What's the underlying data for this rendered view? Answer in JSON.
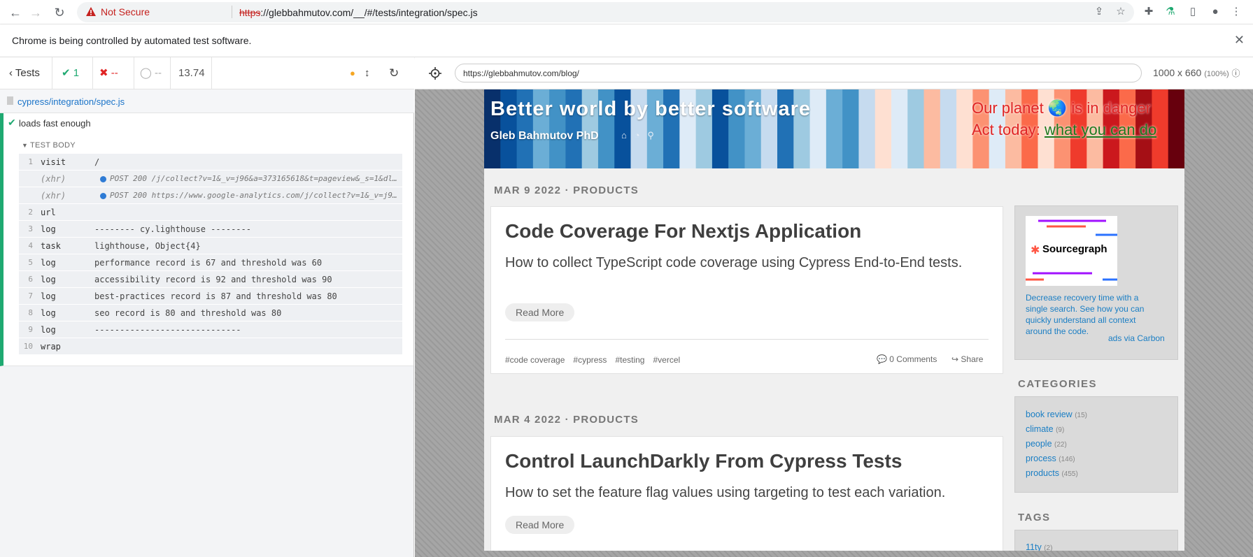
{
  "browser": {
    "security_label": "Not Secure",
    "url_scheme": "https",
    "url_rest": "://glebbahmutov.com/__/#/tests/integration/spec.js",
    "infobar_message": "Chrome is being controlled by automated test software.",
    "close_glyph": "✕"
  },
  "reporter": {
    "back_label": "Tests",
    "passed": "1",
    "failed": "--",
    "pending": "--",
    "duration": "13.74",
    "spec_file": "cypress/integration/spec.js",
    "test_title": "loads fast enough",
    "body_header": "TEST BODY",
    "commands": [
      {
        "num": "1",
        "name": "visit",
        "msg": "/",
        "xhr": false
      },
      {
        "num": "",
        "name": "(xhr)",
        "msg": "POST 200 /j/collect?v=1&_v=j96&a=373165618&t=pageview&_s=1&dl=http…",
        "xhr": true
      },
      {
        "num": "",
        "name": "(xhr)",
        "msg": "POST 200 https://www.google-analytics.com/j/collect?v=1&_v=j96&a=3…",
        "xhr": true
      },
      {
        "num": "2",
        "name": "url",
        "msg": "",
        "xhr": false
      },
      {
        "num": "3",
        "name": "log",
        "msg": "-------- cy.lighthouse --------",
        "xhr": false
      },
      {
        "num": "4",
        "name": "task",
        "msg": "lighthouse, Object{4}",
        "xhr": false
      },
      {
        "num": "5",
        "name": "log",
        "msg": "performance record is 67 and threshold was 60",
        "xhr": false
      },
      {
        "num": "6",
        "name": "log",
        "msg": "accessibility record is 92 and threshold was 90",
        "xhr": false
      },
      {
        "num": "7",
        "name": "log",
        "msg": "best-practices record is 87 and threshold was 80",
        "xhr": false
      },
      {
        "num": "8",
        "name": "log",
        "msg": "seo record is 80 and threshold was 80",
        "xhr": false
      },
      {
        "num": "9",
        "name": "log",
        "msg": "-----------------------------",
        "xhr": false
      },
      {
        "num": "10",
        "name": "wrap",
        "msg": "",
        "xhr": false
      }
    ]
  },
  "aut": {
    "url": "https://glebbahmutov.com/blog/",
    "viewport": "1000 x 660",
    "zoom": "(100%)"
  },
  "site": {
    "title": "Better world by better software",
    "author": "Gleb Bahmutov PhD",
    "planet_line": "Our planet 🌏 is in danger",
    "act_prefix": "Act today: ",
    "act_link": "what you can do",
    "posts": [
      {
        "meta": "MAR 9 2022  ·  PRODUCTS",
        "title": "Code Coverage For Nextjs Application",
        "summary": "How to collect TypeScript code coverage using Cypress End-to-End tests.",
        "read_more": "Read More",
        "tags": [
          "#code coverage",
          "#cypress",
          "#testing",
          "#vercel"
        ],
        "comments": "0 Comments",
        "share": "Share"
      },
      {
        "meta": "MAR 4 2022  ·  PRODUCTS",
        "title": "Control LaunchDarkly From Cypress Tests",
        "summary": "How to set the feature flag values using targeting to test each variation.",
        "read_more": "Read More"
      }
    ],
    "ad": {
      "brand": "Sourcegraph",
      "text": "Decrease recovery time with a single search. See how you can quickly understand all context around the code.",
      "via": "ads via Carbon"
    },
    "categories_heading": "CATEGORIES",
    "categories": [
      {
        "name": "book review",
        "count": "(15)"
      },
      {
        "name": "climate",
        "count": "(9)"
      },
      {
        "name": "people",
        "count": "(22)"
      },
      {
        "name": "process",
        "count": "(146)"
      },
      {
        "name": "products",
        "count": "(455)"
      }
    ],
    "tags_heading": "TAGS",
    "first_tag": {
      "name": "11ty",
      "count": "(2)"
    }
  },
  "colors": {
    "pass_green": "#1fa971",
    "fail_red": "#e02424",
    "link_blue": "#1a7ec4"
  }
}
